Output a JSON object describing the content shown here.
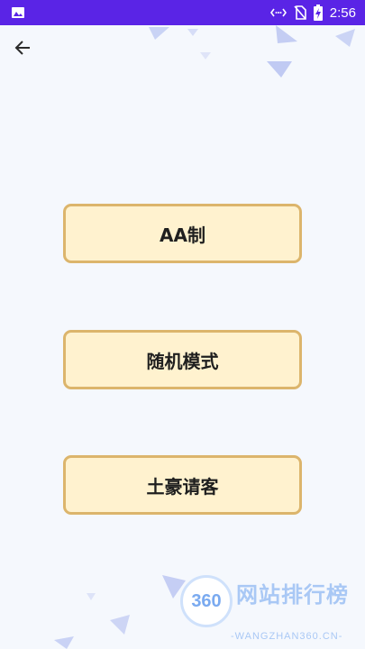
{
  "status_bar": {
    "time": "2:56",
    "icons": [
      "image-icon",
      "data-transfer-icon",
      "no-sim-icon",
      "battery-charging-icon"
    ],
    "background_color": "#5a24e6"
  },
  "header": {
    "back_icon": "arrow-left-icon"
  },
  "menu": {
    "buttons": [
      {
        "label": "AA制"
      },
      {
        "label": "随机模式"
      },
      {
        "label": "土豪请客"
      }
    ],
    "button_fill": "#fff2cf",
    "button_border": "#dcb56c"
  },
  "watermark": {
    "logo_text": "360",
    "title": "网站排行榜",
    "subtitle": "-WANGZHAN360.CN-"
  }
}
